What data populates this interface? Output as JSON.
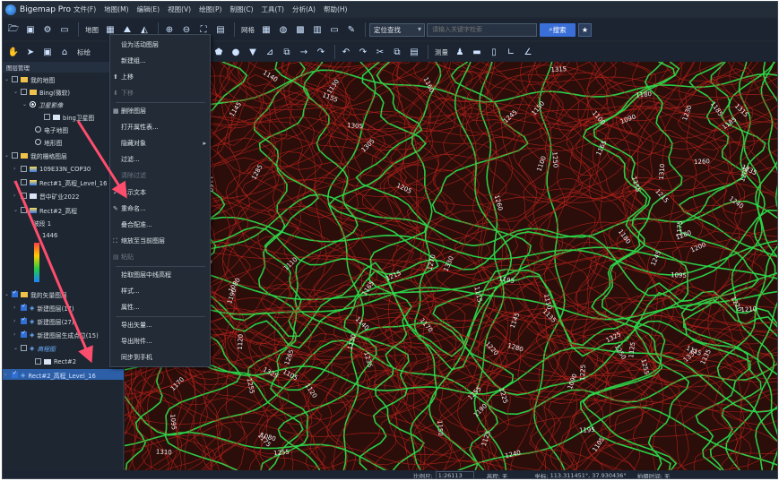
{
  "app": {
    "title": "Bigemap Pro"
  },
  "menubar": [
    "文件(F)",
    "地图(M)",
    "编辑(E)",
    "视图(V)",
    "绘图(P)",
    "制图(C)",
    "工具(T)",
    "分析(A)",
    "帮助(H)"
  ],
  "toolbar1": {
    "map_label": "地图",
    "grid_label": "网格",
    "locate_mode": "定位查找",
    "search_placeholder": "请输入关键字检索",
    "search_button": "搜索",
    "star": "★"
  },
  "toolbar2": {
    "mark_label": "标绘",
    "measure_label": "测量"
  },
  "layer_panel": {
    "title": "图层管理",
    "rows": [
      {
        "label": "我的地图"
      },
      {
        "label": "Bing(微软)"
      },
      {
        "label": "卫星影像"
      },
      {
        "label": "bing卫星图"
      },
      {
        "label": "电子地图"
      },
      {
        "label": "地形图"
      },
      {
        "label": "我的栅格图层"
      },
      {
        "label": "109E33N_COP30"
      },
      {
        "label": "Rect#1_高程_Level_16"
      },
      {
        "label": "晋中矿业2022"
      },
      {
        "label": "Rect#2_高程"
      },
      {
        "label": "波段 1"
      },
      {
        "label": "1446"
      },
      {
        "label": "我的矢量图层"
      },
      {
        "label": "新建图层(17)"
      },
      {
        "label": "新建图层(27)"
      },
      {
        "label": "新建图层生成点位(15)"
      },
      {
        "label": "高程图"
      },
      {
        "label": "Rect#2"
      },
      {
        "label": "Rect#2_高程_Level_16"
      }
    ]
  },
  "context_menu": {
    "items": [
      {
        "label": "设为活动图层",
        "disabled": false
      },
      {
        "label": "新建组...",
        "disabled": false
      },
      {
        "label": "上移",
        "disabled": false,
        "icon": "up-arrow-icon"
      },
      {
        "label": "下移",
        "disabled": true,
        "icon": "down-arrow-icon"
      },
      {
        "label": "删除图层",
        "disabled": false,
        "icon": "delete-icon"
      },
      {
        "label": "打开属性表...",
        "disabled": false
      },
      {
        "label": "隐藏对象",
        "disabled": false,
        "submenu": true
      },
      {
        "label": "过滤...",
        "disabled": false
      },
      {
        "label": "清除过滤",
        "disabled": true
      },
      {
        "label": "显示文本",
        "disabled": false,
        "checked": true
      },
      {
        "label": "重命名...",
        "disabled": false,
        "icon": "rename-icon"
      },
      {
        "label": "叠合配准...",
        "disabled": false
      },
      {
        "label": "缩放至当前图层",
        "disabled": false,
        "icon": "zoom-layer-icon"
      },
      {
        "label": "粘贴",
        "disabled": true,
        "icon": "paste-icon"
      },
      {
        "label": "拾取图层中线高程",
        "disabled": false
      },
      {
        "label": "样式...",
        "disabled": false
      },
      {
        "label": "属性...",
        "disabled": false
      },
      {
        "label": "导出矢量...",
        "disabled": false
      },
      {
        "label": "导出附件...",
        "disabled": false
      },
      {
        "label": "同步到手机",
        "disabled": false
      }
    ]
  },
  "map": {
    "contour_labels": [
      "1250",
      "1235",
      "1255",
      "1240",
      "1220",
      "1270",
      "1265",
      "1230",
      "1325",
      "1330",
      "1255",
      "1315",
      "1165",
      "1195",
      "1200",
      "1210",
      "1225",
      "1180",
      "1190",
      "1170",
      "1185",
      "1140",
      "1120",
      "1125",
      "1150",
      "1160",
      "1135",
      "1110",
      "1115",
      "1105",
      "1100",
      "1090",
      "1155",
      "1175",
      "1215",
      "1245",
      "1260",
      "1285",
      "1280",
      "1300",
      "1310",
      "1305",
      "1205",
      "1145",
      "1130",
      "1095",
      "1080"
    ],
    "colors": {
      "background": "#2b0d0a",
      "minor": "#b8231c",
      "index": "#2bd84a",
      "label": "#f2f2f2"
    }
  },
  "statusbar": {
    "scale_label": "比例尺:",
    "scale_value": "1:26113",
    "elev_label": "高程:",
    "elev_value": "无",
    "coord_label": "坐标:",
    "coord_value": "113.311451°, 37.930436°",
    "time_label": "拍摄时间:",
    "time_value": "无"
  }
}
